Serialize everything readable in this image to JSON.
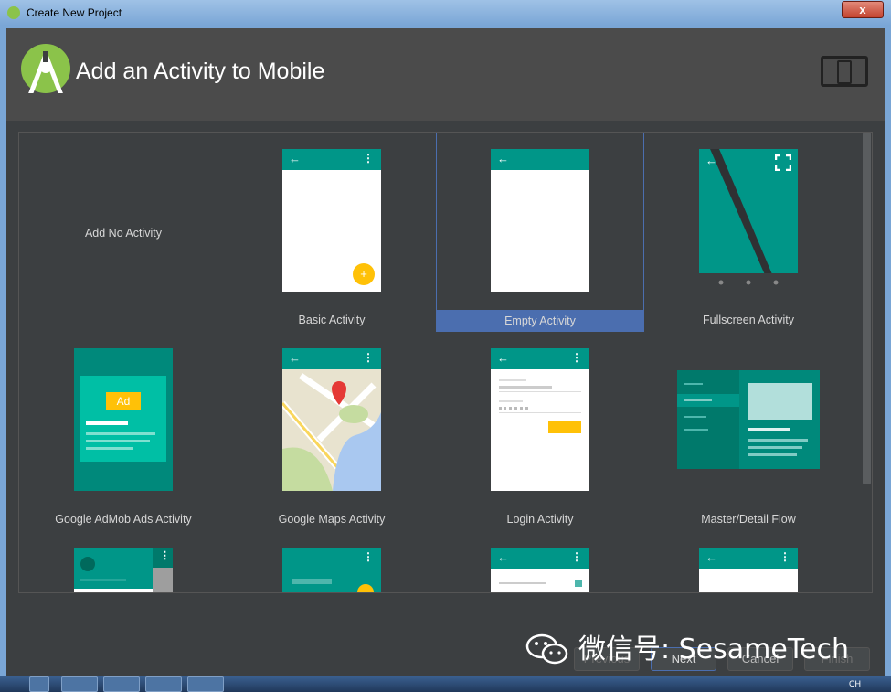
{
  "window": {
    "title": "Create New Project",
    "close_label": "x"
  },
  "header": {
    "title": "Add an Activity to Mobile"
  },
  "gallery": {
    "items": [
      {
        "label": "Add No Activity"
      },
      {
        "label": "Basic Activity"
      },
      {
        "label": "Empty Activity",
        "selected": true
      },
      {
        "label": "Fullscreen Activity"
      },
      {
        "label": "Google AdMob Ads Activity",
        "badge": "Ad"
      },
      {
        "label": "Google Maps Activity"
      },
      {
        "label": "Login Activity"
      },
      {
        "label": "Master/Detail Flow"
      }
    ]
  },
  "buttons": {
    "previous": "Previous",
    "next": "Next",
    "cancel": "Cancel",
    "finish": "Finish"
  },
  "watermark": {
    "text": "微信号: SesameTech"
  },
  "taskbar": {
    "tray_text": "CH"
  },
  "colors": {
    "accent": "#009688",
    "selection": "#4b6eaf",
    "fab": "#ffc107"
  }
}
